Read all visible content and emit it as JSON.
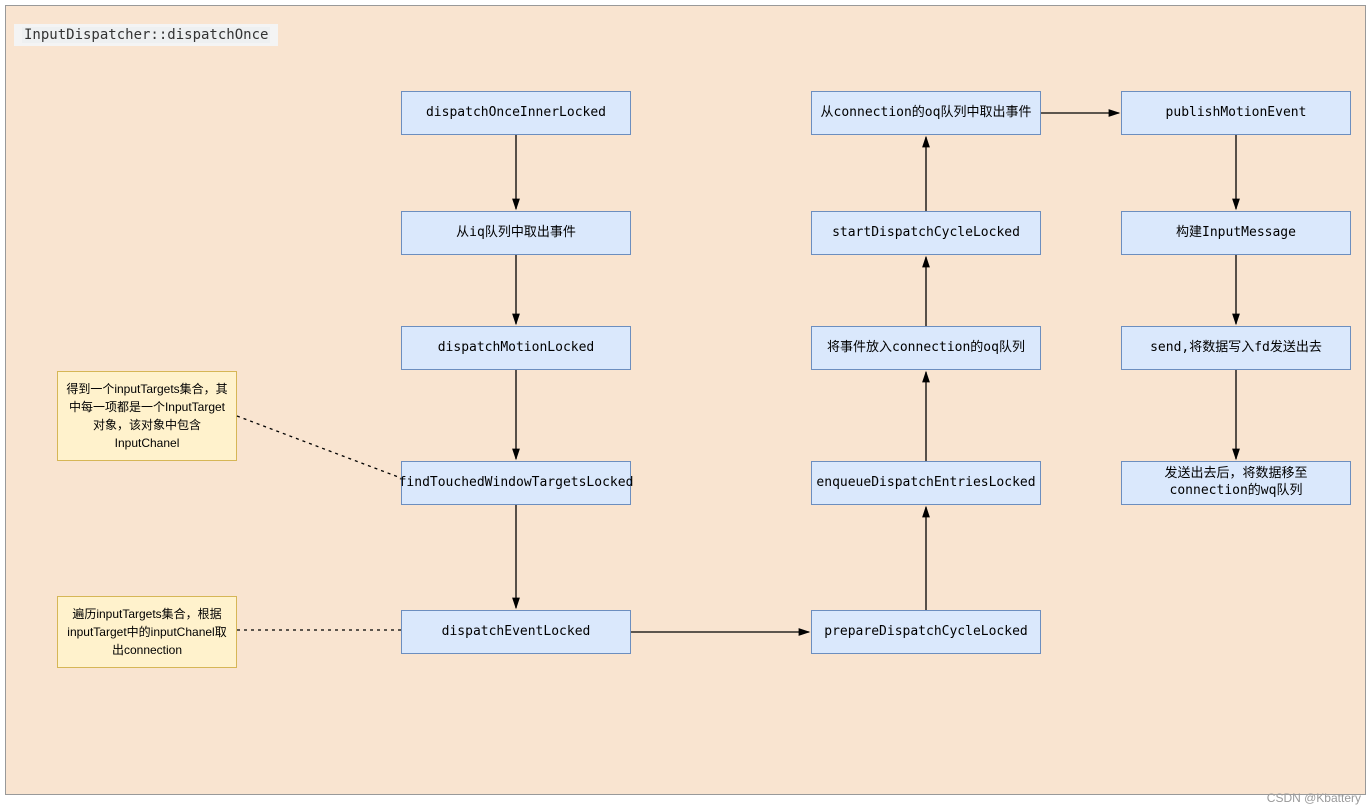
{
  "diagram": {
    "title": "InputDispatcher::dispatchOnce",
    "nodes": {
      "n1": "dispatchOnceInnerLocked",
      "n2": "从iq队列中取出事件",
      "n3": "dispatchMotionLocked",
      "n4": "findTouchedWindowTargetsLocked",
      "n5": "dispatchEventLocked",
      "n6": "prepareDispatchCycleLocked",
      "n7": "enqueueDispatchEntriesLocked",
      "n8": "将事件放入connection的oq队列",
      "n9": "startDispatchCycleLocked",
      "n10": "从connection的oq队列中取出事件",
      "n11": "publishMotionEvent",
      "n12": "构建InputMessage",
      "n13": "send,将数据写入fd发送出去",
      "n14": "发送出去后，将数据移至connection的wq队列"
    },
    "notes": {
      "note1": "得到一个inputTargets集合，其中每一项都是一个InputTarget对象，该对象中包含InputChanel",
      "note2": "遍历inputTargets集合，根据inputTarget中的inputChanel取出connection"
    },
    "watermark": "CSDN @Kbattery"
  }
}
